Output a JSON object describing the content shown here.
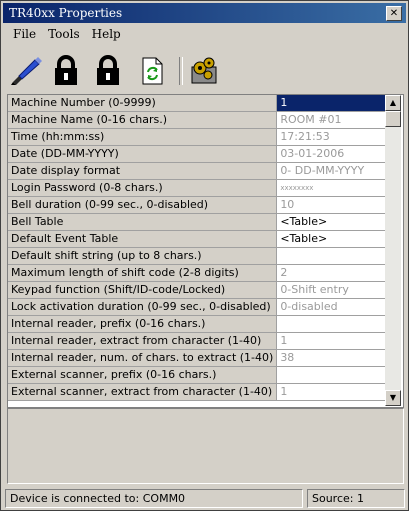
{
  "window": {
    "title": "TR40xx Properties",
    "close": "✕"
  },
  "menu": [
    "File",
    "Tools",
    "Help"
  ],
  "toolbar": [
    "pen-edit-icon",
    "padlock-icon",
    "padlock-icon",
    "refresh-document-icon",
    "settings-gears-icon"
  ],
  "properties": [
    {
      "label": "Machine Number (0-9999)",
      "value": "1"
    },
    {
      "label": "Machine Name (0-16 chars.)",
      "value": "ROOM #01"
    },
    {
      "label": "Time (hh:mm:ss)",
      "value": "17:21:53"
    },
    {
      "label": "Date (DD-MM-YYYY)",
      "value": "03-01-2006"
    },
    {
      "label": "Date display format",
      "value": "0- DD-MM-YYYY"
    },
    {
      "label": "Login Password (0-8 chars.)",
      "value": "xxxxxxxx"
    },
    {
      "label": "Bell duration (0-99 sec., 0-disabled)",
      "value": "10"
    },
    {
      "label": "Bell Table",
      "value": "<Table>"
    },
    {
      "label": "Default Event Table",
      "value": "<Table>"
    },
    {
      "label": "Default shift string (up to 8 chars.)",
      "value": ""
    },
    {
      "label": "Maximum length of shift code (2-8 digits)",
      "value": "2"
    },
    {
      "label": "Keypad function (Shift/ID-code/Locked)",
      "value": "0-Shift entry"
    },
    {
      "label": "Lock activation duration (0-99 sec., 0-disabled)",
      "value": "0-disabled"
    },
    {
      "label": "Internal reader, prefix (0-16 chars.)",
      "value": ""
    },
    {
      "label": "Internal reader, extract from character (1-40)",
      "value": "1"
    },
    {
      "label": "Internal reader, num. of chars. to extract (1-40)",
      "value": "38"
    },
    {
      "label": "External scanner, prefix (0-16 chars.)",
      "value": ""
    },
    {
      "label": "External scanner, extract from character (1-40)",
      "value": "1"
    }
  ],
  "status": {
    "connection": "Device is connected to: COMM0",
    "source": "Source: 1"
  },
  "colors": {
    "title_bar": "#0a246a",
    "selection": "#0a246a",
    "face": "#d4d0c8"
  }
}
